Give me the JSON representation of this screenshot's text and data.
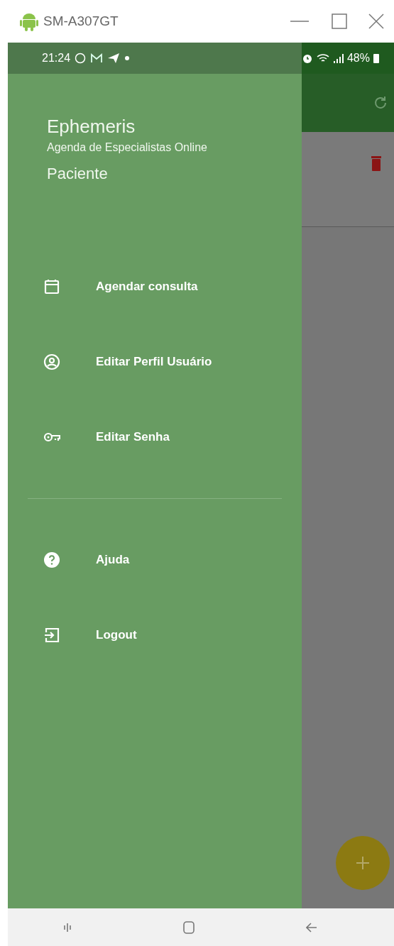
{
  "window": {
    "title": "SM-A307GT"
  },
  "status_bar": {
    "time": "21:24",
    "battery": "48%"
  },
  "drawer": {
    "title": "Ephemeris",
    "subtitle": "Agenda de Especialistas Online",
    "role": "Paciente",
    "groups": [
      [
        {
          "label": "Agendar consulta",
          "kind": "calendar"
        },
        {
          "label": "Editar Perfil Usuário",
          "kind": "profile"
        },
        {
          "label": "Editar Senha",
          "kind": "key"
        }
      ],
      [
        {
          "label": "Ajuda",
          "kind": "help"
        },
        {
          "label": "Logout",
          "kind": "logout"
        }
      ]
    ]
  }
}
